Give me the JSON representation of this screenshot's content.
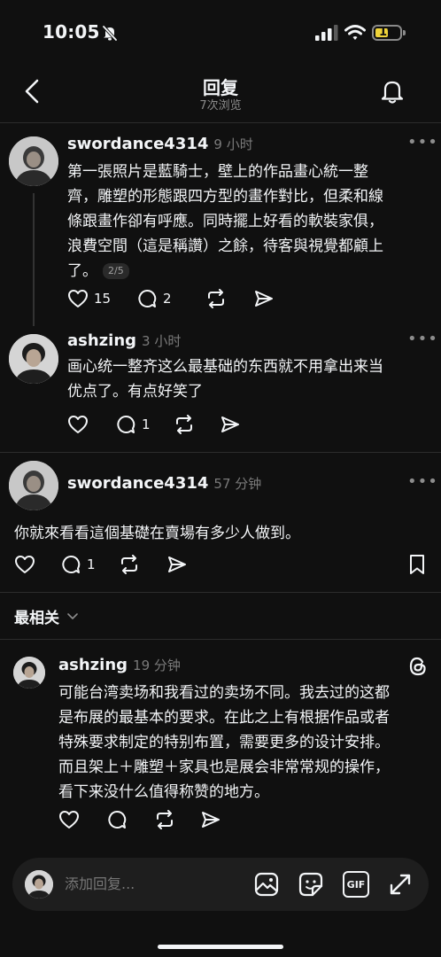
{
  "status_bar": {
    "time": "10:05",
    "battery": "19"
  },
  "header": {
    "title": "回复",
    "subtitle": "7次浏览"
  },
  "comments": [
    {
      "username": "swordance4314",
      "time": "9 小时",
      "lines": [
        "第一張照片是藍騎士，壁上的作品畫心統一整",
        "齊，雕塑的形態跟四方型的畫作對比，但柔和線",
        "條跟畫作卻有呼應。同時擺上好看的軟裝家俱，",
        "浪費空間（這是稱讚）之餘，待客與視覺都顧上",
        "了。"
      ],
      "page_badge": "2/5",
      "likes": "15",
      "replies": "2"
    },
    {
      "username": "ashzing",
      "time": "3 小时",
      "lines": [
        "画心统一整齐这么最基础的东西就不用拿出来当",
        "优点了。有点好笑了"
      ],
      "replies": "1"
    },
    {
      "username": "swordance4314",
      "time": "57 分钟",
      "text": "你就來看看這個基礎在賣場有多少人做到。",
      "replies": "1"
    }
  ],
  "related": {
    "label": "最相关",
    "comment": {
      "username": "ashzing",
      "time": "19 分钟",
      "lines": [
        "可能台湾卖场和我看过的卖场不同。我去过的这都",
        "是布展的最基本的要求。在此之上有根据作品或者",
        "特殊要求制定的特别布置，需要更多的设计安排。",
        "而且架上＋雕塑＋家具也是展会非常常规的操作，",
        "看下来没什么值得称赞的地方。"
      ]
    }
  },
  "composer": {
    "placeholder": "添加回复...",
    "gif_label": "GIF"
  },
  "icons": [
    "back-arrow-icon",
    "bell-icon",
    "heart-icon",
    "comment-icon",
    "repost-icon",
    "share-icon",
    "bookmark-icon",
    "threads-logo-icon",
    "image-icon",
    "sticker-icon",
    "gif-icon",
    "expand-icon",
    "mute-bell-icon",
    "signal-icon",
    "wifi-icon"
  ]
}
